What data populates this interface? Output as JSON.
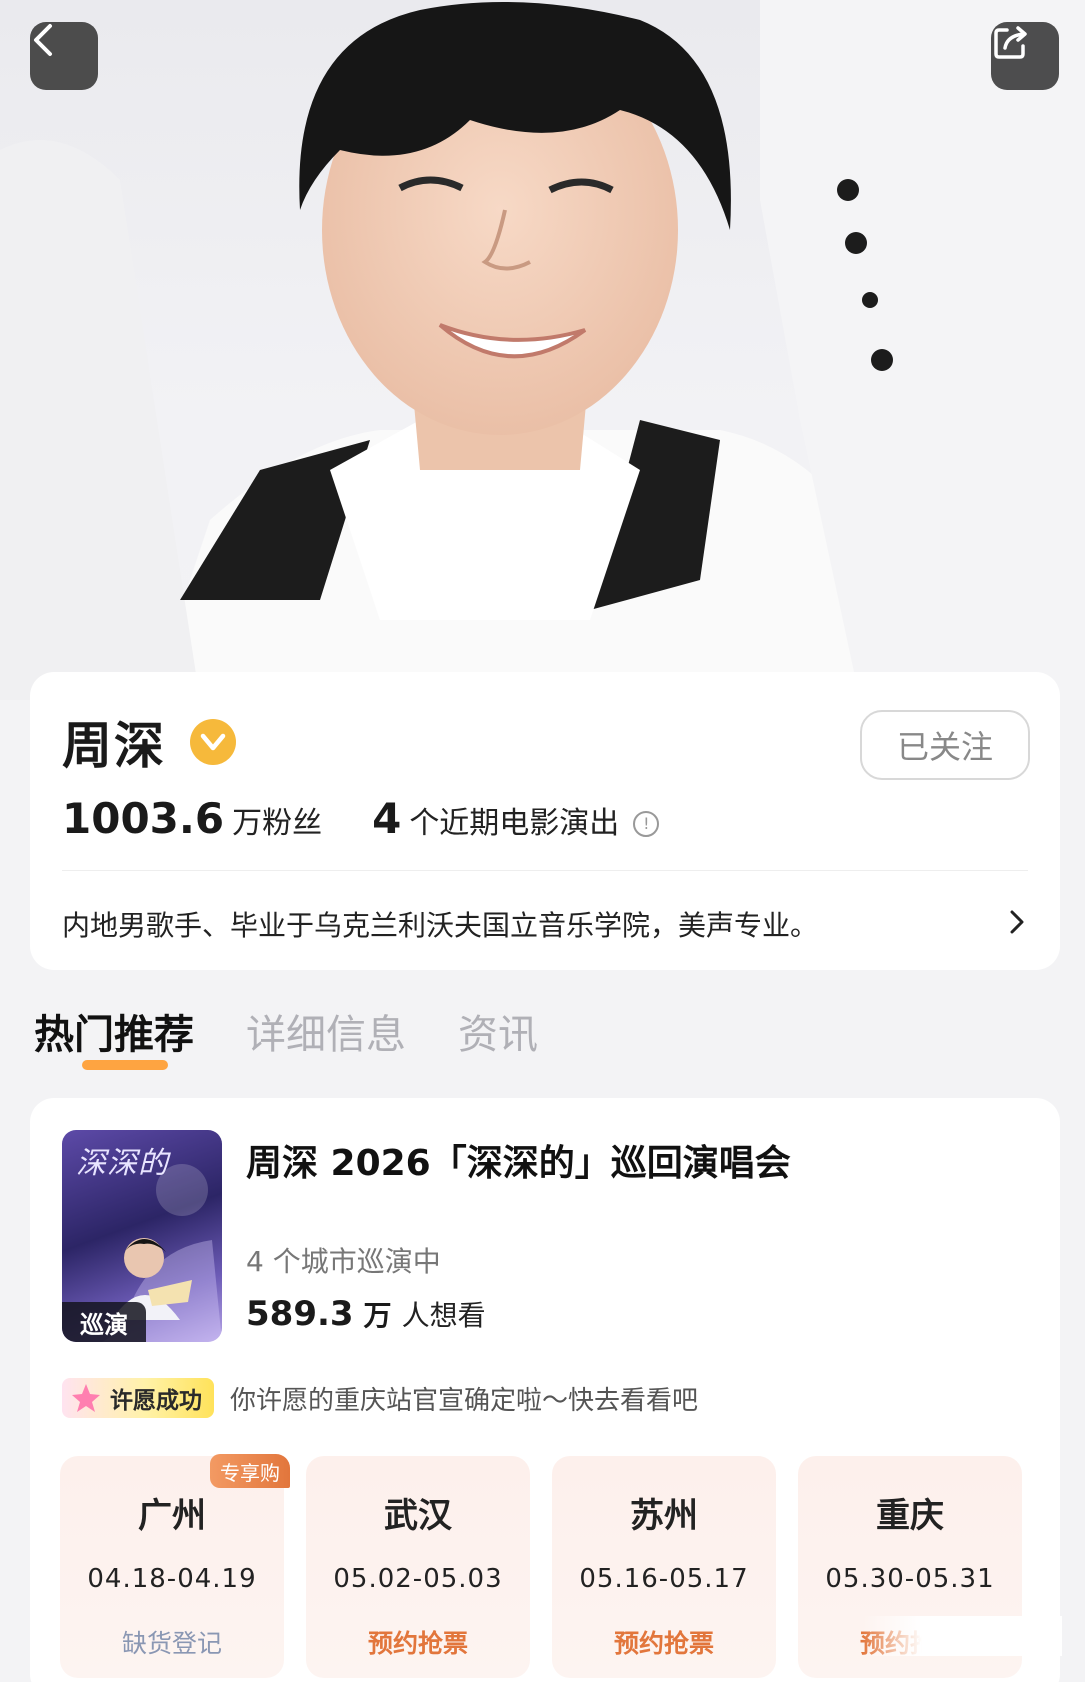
{
  "nav": {
    "back_icon": "chevron-left-icon",
    "share_icon": "share-icon"
  },
  "artist": {
    "name": "周深",
    "verified_icon": "verified-badge-icon",
    "follow_label": "已关注",
    "fans_count": "1003.6",
    "fans_label": "万粉丝",
    "shows_count": "4",
    "shows_label": "个近期电影演出",
    "bio": "内地男歌手、毕业于乌克兰利沃夫国立音乐学院，美声专业。"
  },
  "tabs": [
    {
      "label": "热门推荐",
      "active": true
    },
    {
      "label": "详细信息",
      "active": false
    },
    {
      "label": "资讯",
      "active": false
    }
  ],
  "event": {
    "poster_title": "深深的",
    "poster_badge": "巡演",
    "title": "周深 2026「深深的」巡回演唱会",
    "subtitle": "4 个城市巡演中",
    "want_count": "589.3",
    "want_unit": "万",
    "want_label": "人想看",
    "wish_tag": "许愿成功",
    "wish_text": "你许愿的重庆站官宣确定啦～快去看看吧",
    "cities": [
      {
        "name": "广州",
        "date": "04.18-04.19",
        "action": "缺货登记",
        "tag": "专享购"
      },
      {
        "name": "武汉",
        "date": "05.02-05.03",
        "action": "预约抢票",
        "tag": ""
      },
      {
        "name": "苏州",
        "date": "05.16-05.17",
        "action": "预约抢票",
        "tag": ""
      },
      {
        "name": "重庆",
        "date": "05.30-05.31",
        "action": "预约抢票",
        "tag": ""
      }
    ]
  },
  "colors": {
    "accent": "#ff9b2e",
    "action": "#e2763c",
    "soldout": "#8a97b3",
    "verified": "#f6b93b"
  }
}
